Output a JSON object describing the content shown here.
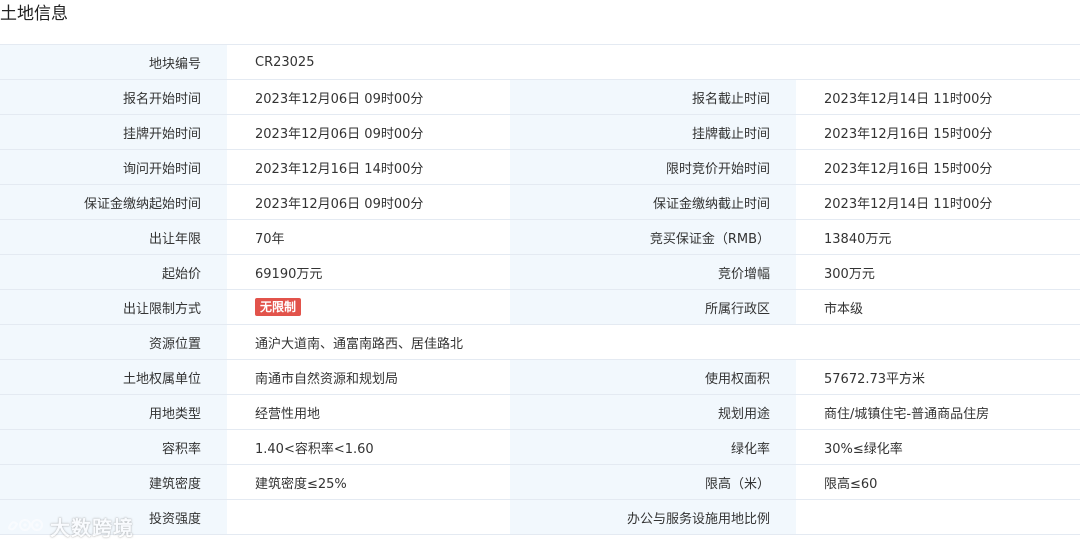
{
  "section_title": "土地信息",
  "rows": [
    {
      "l1": "地块编号",
      "v1": "CR23025",
      "l2": "",
      "v2": ""
    },
    {
      "l1": "报名开始时间",
      "v1": "2023年12月06日 09时00分",
      "l2": "报名截止时间",
      "v2": "2023年12月14日 11时00分"
    },
    {
      "l1": "挂牌开始时间",
      "v1": "2023年12月06日 09时00分",
      "l2": "挂牌截止时间",
      "v2": "2023年12月16日 15时00分"
    },
    {
      "l1": "询问开始时间",
      "v1": "2023年12月16日 14时00分",
      "l2": "限时竞价开始时间",
      "v2": "2023年12月16日 15时00分"
    },
    {
      "l1": "保证金缴纳起始时间",
      "v1": "2023年12月06日 09时00分",
      "l2": "保证金缴纳截止时间",
      "v2": "2023年12月14日 11时00分"
    },
    {
      "l1": "出让年限",
      "v1": "70年",
      "l2": "竞买保证金（RMB）",
      "v2": "13840万元"
    },
    {
      "l1": "起始价",
      "v1": "69190万元",
      "l2": "竞价增幅",
      "v2": "300万元"
    },
    {
      "l1": "出让限制方式",
      "v1": "无限制",
      "l2": "所属行政区",
      "v2": "市本级"
    },
    {
      "l1": "资源位置",
      "v1": "通沪大道南、通富南路西、居佳路北",
      "l2": "",
      "v2": ""
    },
    {
      "l1": "土地权属单位",
      "v1": "南通市自然资源和规划局",
      "l2": "使用权面积",
      "v2": "57672.73平方米"
    },
    {
      "l1": "用地类型",
      "v1": "经营性用地",
      "l2": "规划用途",
      "v2": "商住/城镇住宅-普通商品住房"
    },
    {
      "l1": "容积率",
      "v1": "1.40<容积率<1.60",
      "l2": "绿化率",
      "v2": "30%≤绿化率"
    },
    {
      "l1": "建筑密度",
      "v1": "建筑密度≤25%",
      "l2": "限高（米）",
      "v2": "限高≤60"
    },
    {
      "l1": "投资强度",
      "v1": "",
      "l2": "办公与服务设施用地比例",
      "v2": ""
    }
  ],
  "watermark": {
    "text": "大数跨境",
    "icon": "eye-logo-icon"
  },
  "colors": {
    "label_bg": "#f2f8fd",
    "border": "#e4eaf2",
    "badge": "#e2534b"
  }
}
